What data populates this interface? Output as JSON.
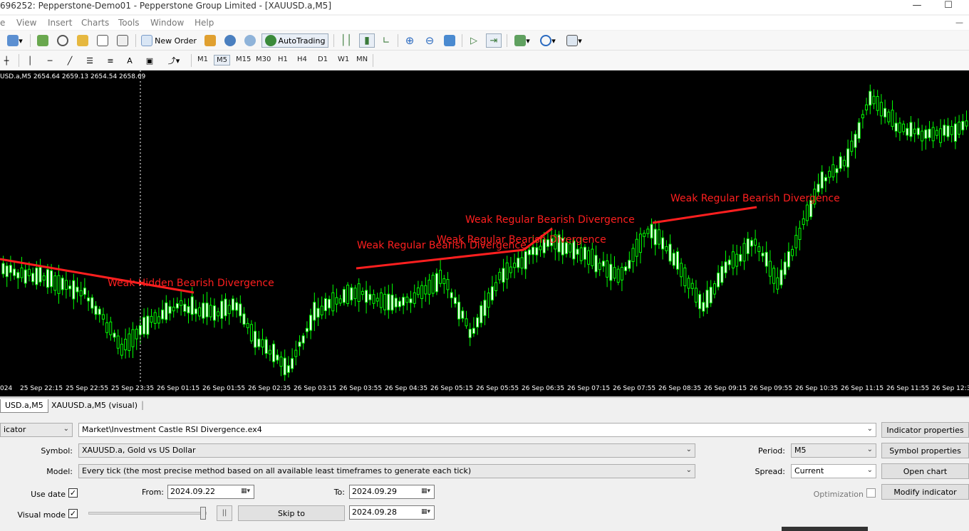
{
  "window": {
    "title": "696252: Pepperstone-Demo01 - Pepperstone Group Limited - [XAUUSD.a,M5]",
    "minimize_icon": "minimize-icon",
    "maximize_icon": "maximize-icon"
  },
  "menu": [
    "e",
    "View",
    "Insert",
    "Charts",
    "Tools",
    "Window",
    "Help"
  ],
  "toolbar": {
    "new_order": "New Order",
    "autotrading": "AutoTrading"
  },
  "timeframes": [
    "M1",
    "M5",
    "M15",
    "M30",
    "H1",
    "H4",
    "D1",
    "W1",
    "MN"
  ],
  "active_timeframe": "M5",
  "chart": {
    "info": "USD.a,M5  2654.64 2659.13 2654.54 2658.69",
    "divergence_labels": [
      "Weak Hidden Bearish Divergence",
      "Weak Regular Bearish Divergence",
      "Weak Regular Bearish Divergence",
      "Weak Regular Bearish Divergence",
      "Weak Regular Bearish Divergence"
    ],
    "time_labels": [
      "024",
      "25 Sep 22:15",
      "25 Sep 22:55",
      "25 Sep 23:35",
      "26 Sep 01:15",
      "26 Sep 01:55",
      "26 Sep 02:35",
      "26 Sep 03:15",
      "26 Sep 03:55",
      "26 Sep 04:35",
      "26 Sep 05:15",
      "26 Sep 05:55",
      "26 Sep 06:35",
      "26 Sep 07:15",
      "26 Sep 07:55",
      "26 Sep 08:35",
      "26 Sep 09:15",
      "26 Sep 09:55",
      "26 Sep 10:35",
      "26 Sep 11:15",
      "26 Sep 11:55",
      "26 Sep 12:35"
    ],
    "colors": {
      "background": "#000000",
      "candles": "#00ff00",
      "divergence": "#ff1f1f"
    }
  },
  "tabs": [
    "USD.a,M5",
    "XAUUSD.a,M5 (visual)"
  ],
  "tester": {
    "type_value": "icator",
    "expert_path": "Market\\Investment Castle RSI Divergence.ex4",
    "symbol_label": "Symbol:",
    "symbol_value": "XAUUSD.a, Gold vs US Dollar",
    "model_label": "Model:",
    "model_value": "Every tick (the most precise method based on all available least timeframes to generate each tick)",
    "use_date_label": "Use date",
    "use_date_checked": true,
    "from_label": "From:",
    "from_value": "2024.09.22",
    "to_label": "To:",
    "to_value": "2024.09.29",
    "visual_mode_label": "Visual mode",
    "visual_mode_checked": true,
    "pause_label": "||",
    "skip_to_label": "Skip to",
    "skip_to_value": "2024.09.28",
    "period_label": "Period:",
    "period_value": "M5",
    "spread_label": "Spread:",
    "spread_value": "Current",
    "optimization_label": "Optimization",
    "optimization_checked": false,
    "buttons": {
      "indicator_properties": "Indicator properties",
      "symbol_properties": "Symbol properties",
      "open_chart": "Open chart",
      "modify_indicator": "Modify indicator"
    }
  }
}
